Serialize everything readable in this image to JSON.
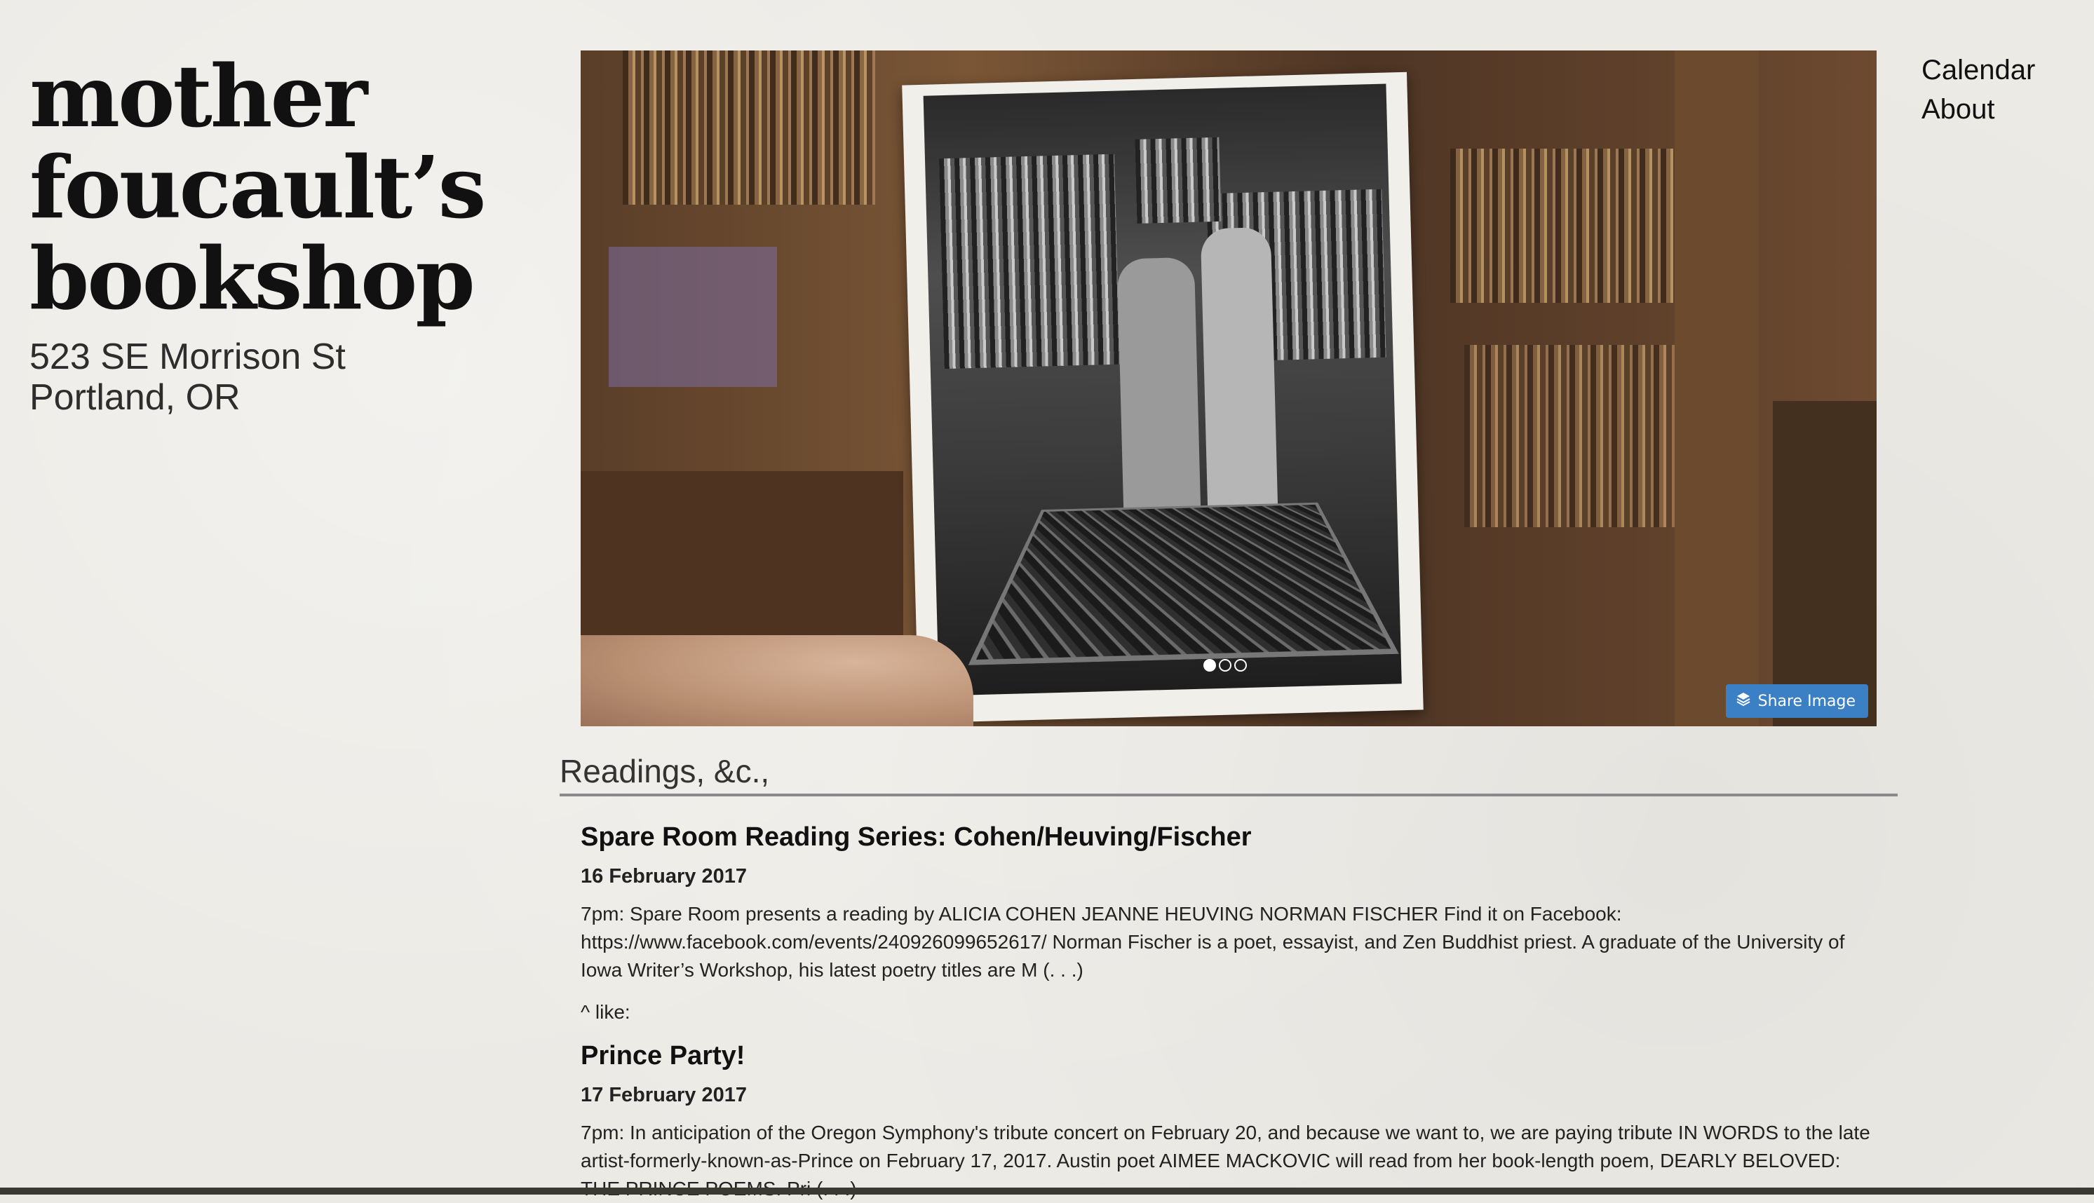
{
  "brand": {
    "name_lines": [
      "mother",
      "foucault’s",
      "bookshop"
    ],
    "address_lines": [
      "523 SE Morrison St",
      "Portland, OR"
    ]
  },
  "nav": {
    "items": [
      {
        "label": "Calendar"
      },
      {
        "label": "About"
      }
    ]
  },
  "slideshow": {
    "share_label": "Share Image",
    "dots_total": 3,
    "active_dot": 1,
    "colors": {
      "share_bg": "#3b7fc4"
    }
  },
  "section": {
    "title": "Readings, &c.,"
  },
  "events": [
    {
      "title": "Spare Room Reading Series: Cohen/Heuving/Fischer",
      "date": "16 February 2017",
      "body": "7pm: Spare Room presents a reading by ALICIA COHEN JEANNE HEUVING NORMAN FISCHER Find it on Facebook: https://www.facebook.com/events/240926099652617/ Norman Fischer is a poet, essayist, and Zen Buddhist priest. A graduate of the University of Iowa Writer’s Workshop, his latest poetry titles are M (. . .)"
    },
    {
      "title": "Prince Party!",
      "date": "17 February 2017",
      "body": "7pm: In anticipation of the Oregon Symphony's tribute concert on February 20, and because we want to, we are paying tribute IN WORDS to the late artist-formerly-known-as-Prince on February 17, 2017. Austin poet AIMEE MACKOVIC will read from her book-length poem, DEARLY BELOVED: THE PRINCE POEMS. Pri (. . .)"
    }
  ],
  "like_label": "^ like:"
}
